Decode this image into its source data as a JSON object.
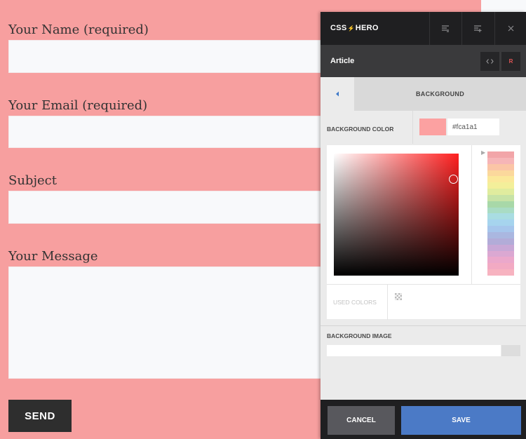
{
  "form": {
    "name_label": "Your Name (required)",
    "email_label": "Your Email (required)",
    "subject_label": "Subject",
    "message_label": "Your Message",
    "send_label": "SEND",
    "background_color": "#f79f9f"
  },
  "csshero": {
    "logo_left": "CSS",
    "logo_right": "HERO",
    "header_icons": [
      "align-icon",
      "add-rule-icon",
      "close-icon"
    ],
    "selected_element": "Article",
    "code_button_icon": "code-icon",
    "reset_button_label": "R",
    "section_title": "BACKGROUND",
    "background_color_label": "BACKGROUND COLOR",
    "background_color_value": "#fca1a1",
    "used_colors_label": "USED COLORS",
    "background_image_label": "BACKGROUND IMAGE",
    "cancel_label": "CANCEL",
    "save_label": "SAVE",
    "colors": {
      "header_bg": "#1f1f21",
      "subheader_bg": "#3a3a3c",
      "panel_bg": "#ebebeb",
      "save_bg": "#4b7ac6",
      "cancel_bg": "#58585d",
      "reset_text": "#e05555"
    },
    "palette": [
      "#f2a5a8",
      "#f6b5b7",
      "#fbc5a6",
      "#fbd89c",
      "#fbe89a",
      "#f3ef9a",
      "#e0ec9e",
      "#c7e3a6",
      "#a8d8a8",
      "#a9dcc4",
      "#a9dde2",
      "#a6d4ee",
      "#a6c6ec",
      "#aab7e0",
      "#b2acd8",
      "#c8a8d6",
      "#dba8d2",
      "#eba8cb",
      "#f2aac3",
      "#f7b3c0"
    ]
  }
}
